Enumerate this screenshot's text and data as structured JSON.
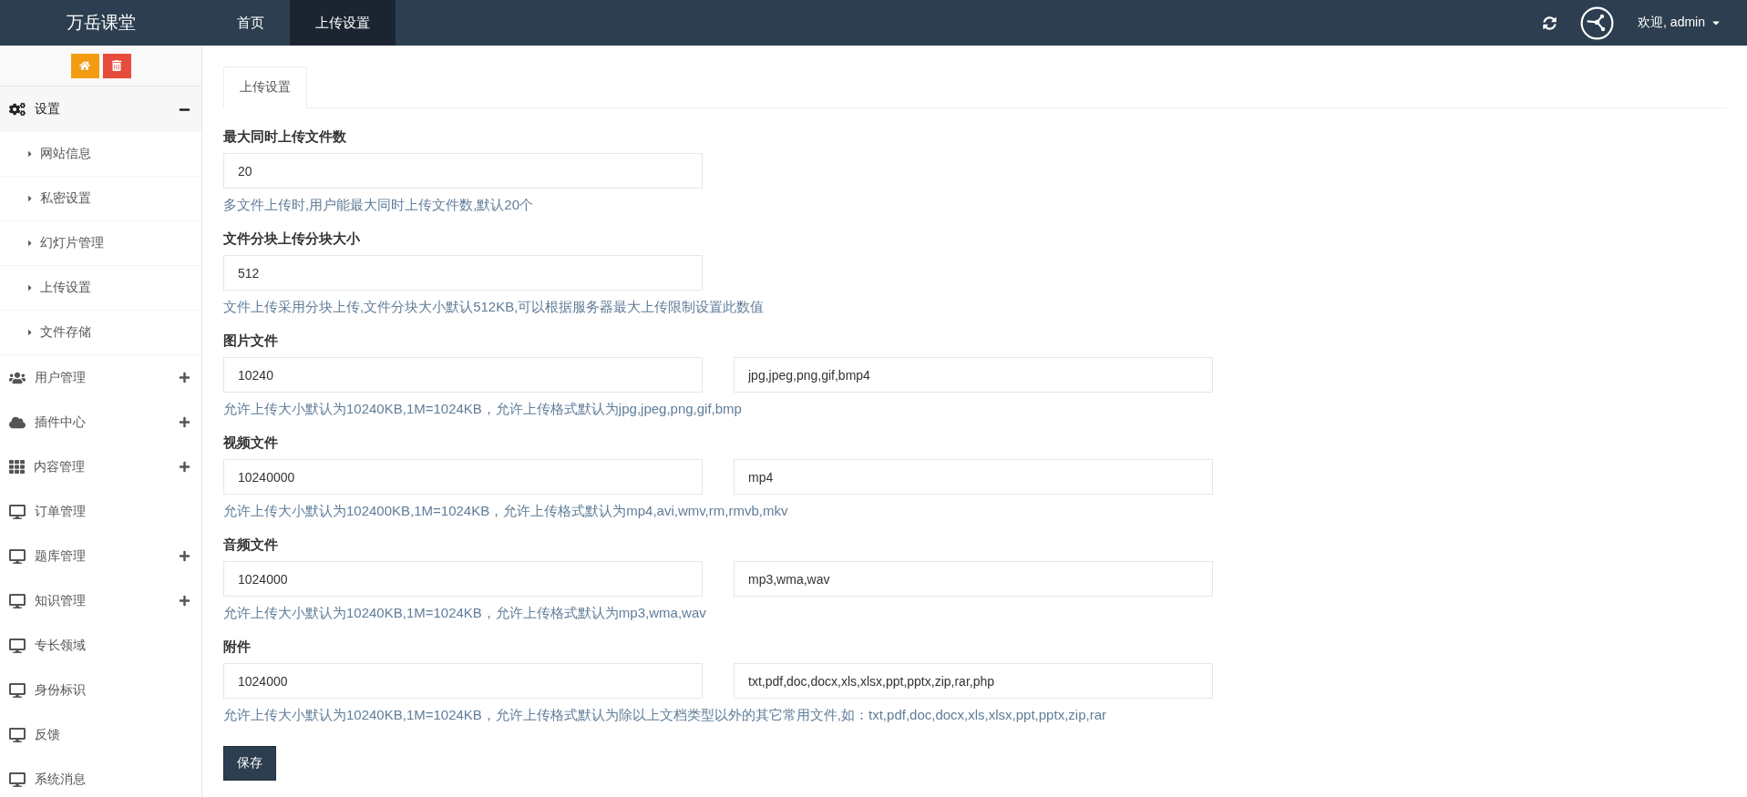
{
  "brand": "万岳课堂",
  "nav": [
    {
      "label": "首页",
      "selected": false
    },
    {
      "label": "上传设置",
      "selected": true
    }
  ],
  "user": {
    "greeting": "欢迎, admin"
  },
  "sidebar": {
    "items": [
      {
        "kind": "settings",
        "label": "设置",
        "has_children": true,
        "expanded": true,
        "children": [
          {
            "label": "网站信息"
          },
          {
            "label": "私密设置"
          },
          {
            "label": "幻灯片管理"
          },
          {
            "label": "上传设置"
          },
          {
            "label": "文件存储"
          }
        ]
      },
      {
        "kind": "users",
        "label": "用户管理",
        "has_children": true,
        "expanded": false
      },
      {
        "kind": "plugins",
        "label": "插件中心",
        "has_children": true,
        "expanded": false
      },
      {
        "kind": "content",
        "label": "内容管理",
        "has_children": true,
        "expanded": false
      },
      {
        "kind": "page",
        "label": "订单管理",
        "has_children": false,
        "expanded": false
      },
      {
        "kind": "page",
        "label": "题库管理",
        "has_children": true,
        "expanded": false
      },
      {
        "kind": "page",
        "label": "知识管理",
        "has_children": true,
        "expanded": false
      },
      {
        "kind": "page",
        "label": "专长领域",
        "has_children": false,
        "expanded": false
      },
      {
        "kind": "page",
        "label": "身份标识",
        "has_children": false,
        "expanded": false
      },
      {
        "kind": "page",
        "label": "反馈",
        "has_children": false,
        "expanded": false
      },
      {
        "kind": "page",
        "label": "系统消息",
        "has_children": false,
        "expanded": false
      }
    ]
  },
  "tabs": [
    {
      "label": "上传设置",
      "selected": true
    }
  ],
  "form": {
    "sections": [
      {
        "label": "最大同时上传文件数",
        "fields": [
          {
            "value": "20"
          }
        ],
        "help": "多文件上传时,用户能最大同时上传文件数,默认20个"
      },
      {
        "label": "文件分块上传分块大小",
        "fields": [
          {
            "value": "512"
          }
        ],
        "help": "文件上传采用分块上传,文件分块大小默认512KB,可以根据服务器最大上传限制设置此数值"
      },
      {
        "label": "图片文件",
        "fields": [
          {
            "value": "10240"
          },
          {
            "value": "jpg,jpeg,png,gif,bmp4"
          }
        ],
        "help": "允许上传大小默认为10240KB,1M=1024KB，允许上传格式默认为jpg,jpeg,png,gif,bmp"
      },
      {
        "label": "视频文件",
        "fields": [
          {
            "value": "10240000"
          },
          {
            "value": "mp4"
          }
        ],
        "help": "允许上传大小默认为102400KB,1M=1024KB，允许上传格式默认为mp4,avi,wmv,rm,rmvb,mkv"
      },
      {
        "label": "音频文件",
        "fields": [
          {
            "value": "1024000"
          },
          {
            "value": "mp3,wma,wav"
          }
        ],
        "help": "允许上传大小默认为10240KB,1M=1024KB，允许上传格式默认为mp3,wma,wav"
      },
      {
        "label": "附件",
        "fields": [
          {
            "value": "1024000"
          },
          {
            "value": "txt,pdf,doc,docx,xls,xlsx,ppt,pptx,zip,rar,php"
          }
        ],
        "help": "允许上传大小默认为10240KB,1M=1024KB，允许上传格式默认为除以上文档类型以外的其它常用文件,如：txt,pdf,doc,docx,xls,xlsx,ppt,pptx,zip,rar"
      }
    ],
    "submit": "保存"
  }
}
